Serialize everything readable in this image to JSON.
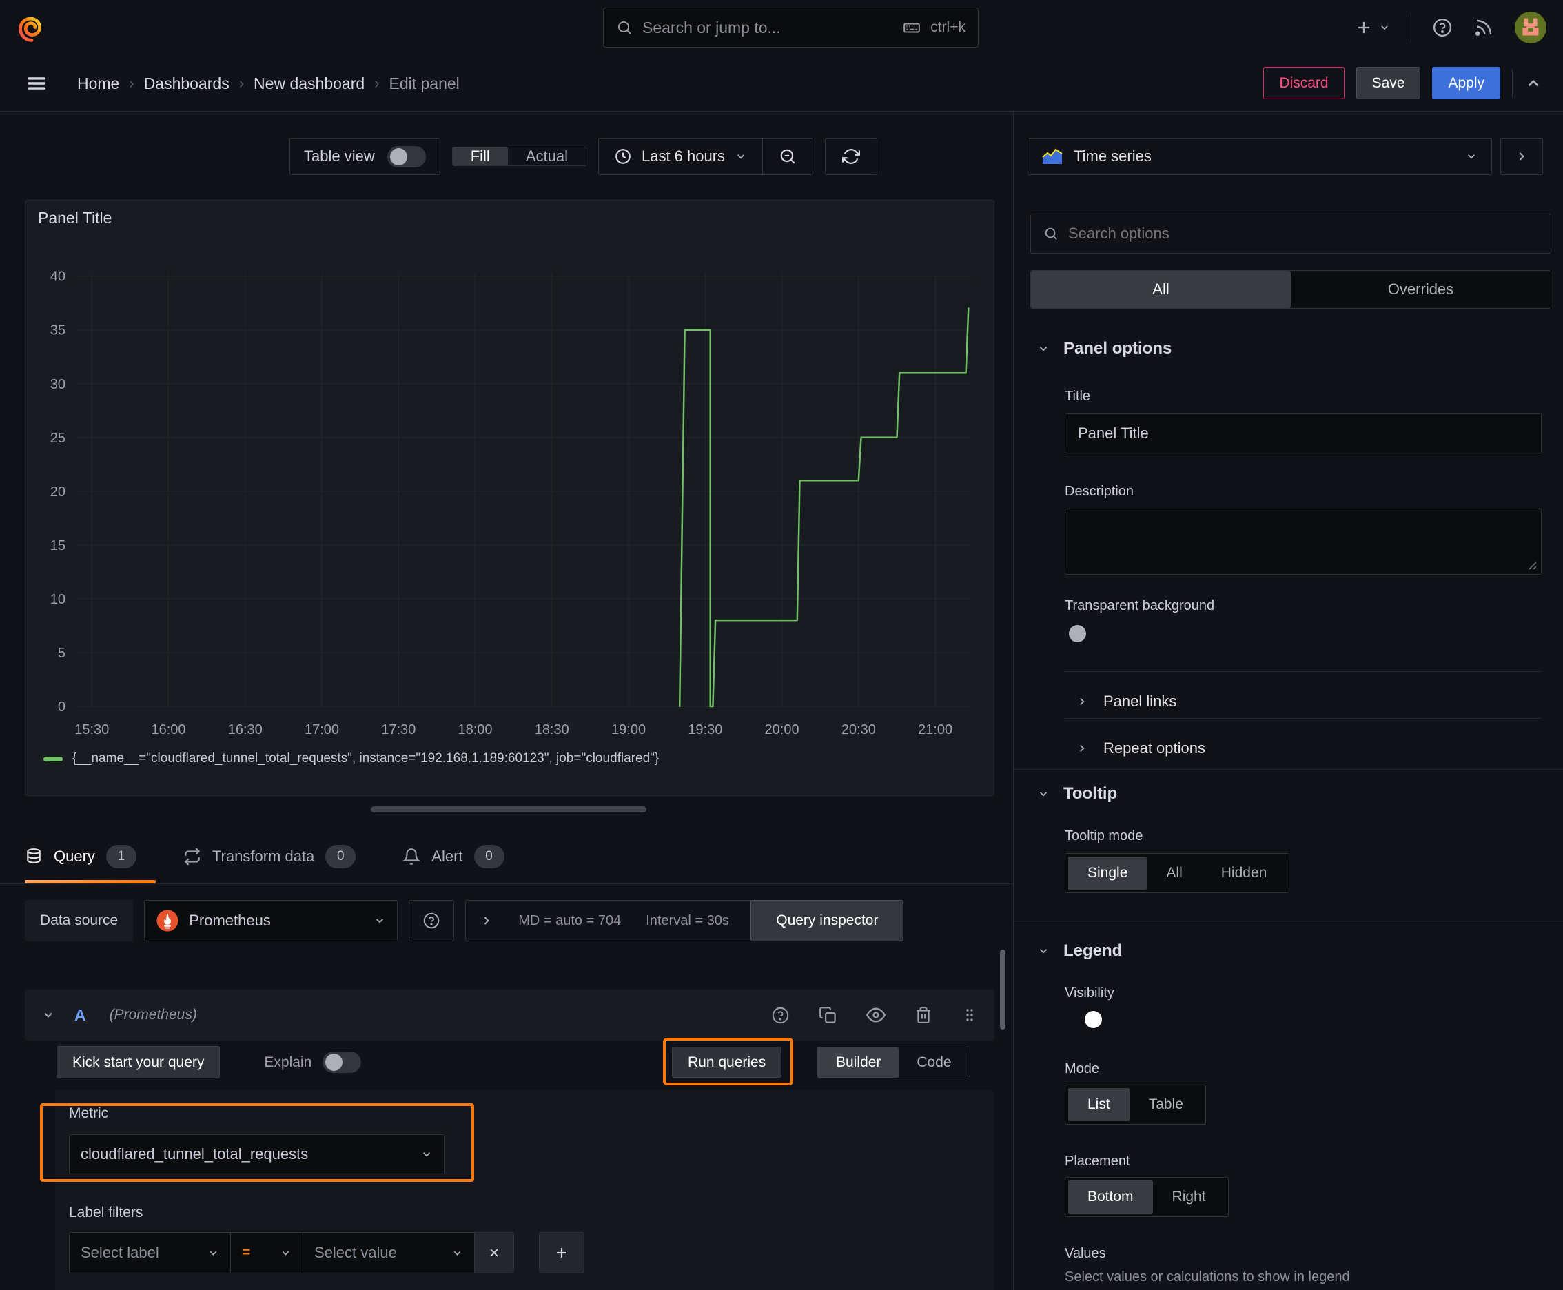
{
  "topbar": {
    "search_placeholder": "Search or jump to...",
    "shortcut": "ctrl+k"
  },
  "breadcrumb": {
    "items": [
      "Home",
      "Dashboards",
      "New dashboard",
      "Edit panel"
    ]
  },
  "actions": {
    "discard": "Discard",
    "save": "Save",
    "apply": "Apply"
  },
  "view_toolbar": {
    "table_view": "Table view",
    "fill": "Fill",
    "actual": "Actual",
    "time_range": "Last 6 hours"
  },
  "panel": {
    "title": "Panel Title"
  },
  "chart_data": {
    "type": "line",
    "title": "Panel Title",
    "x_ticks": [
      "15:30",
      "16:00",
      "16:30",
      "17:00",
      "17:30",
      "18:00",
      "18:30",
      "19:00",
      "19:30",
      "20:00",
      "20:30",
      "21:00"
    ],
    "y_ticks": [
      0,
      5,
      10,
      15,
      20,
      25,
      30,
      35,
      40
    ],
    "ylim": [
      0,
      40.3
    ],
    "x_window": [
      "15:24",
      "21:14"
    ],
    "grid": true,
    "legend_position": "bottom",
    "series": [
      {
        "name": "{__name__=\"cloudflared_tunnel_total_requests\", instance=\"192.168.1.189:60123\", job=\"cloudflared\"}",
        "color": "#73bf69",
        "points": [
          [
            "19:20",
            0
          ],
          [
            "19:22",
            35
          ],
          [
            "19:32",
            35
          ],
          [
            "19:32",
            0
          ],
          [
            "19:33",
            0
          ],
          [
            "19:34",
            8
          ],
          [
            "20:06",
            8
          ],
          [
            "20:07",
            21
          ],
          [
            "20:30",
            21
          ],
          [
            "20:31",
            25
          ],
          [
            "20:45",
            25
          ],
          [
            "20:46",
            31
          ],
          [
            "21:12",
            31
          ],
          [
            "21:13",
            37
          ]
        ]
      }
    ]
  },
  "tabs": {
    "query": {
      "label": "Query",
      "count": "1"
    },
    "transform": {
      "label": "Transform data",
      "count": "0"
    },
    "alert": {
      "label": "Alert",
      "count": "0"
    }
  },
  "query": {
    "datasource_label": "Data source",
    "datasource_value": "Prometheus",
    "expand_stats": {
      "md": "MD = auto = 704",
      "interval": "Interval = 30s"
    },
    "inspector_label": "Query inspector",
    "row_letter": "A",
    "row_datasource": "(Prometheus)",
    "kickstart_label": "Kick start your query",
    "explain_label": "Explain",
    "run_label": "Run queries",
    "builder_label": "Builder",
    "code_label": "Code",
    "metric_label": "Metric",
    "metric_value": "cloudflared_tunnel_total_requests",
    "label_filters_label": "Label filters",
    "select_label_placeholder": "Select label",
    "operator": "=",
    "select_value_placeholder": "Select value"
  },
  "options": {
    "viz_type": "Time series",
    "search_placeholder": "Search options",
    "tab_all": "All",
    "tab_overrides": "Overrides",
    "panel_options": {
      "header": "Panel options",
      "title_label": "Title",
      "title_value": "Panel Title",
      "description_label": "Description",
      "transparent_label": "Transparent background",
      "links_label": "Panel links",
      "repeat_label": "Repeat options"
    },
    "tooltip": {
      "header": "Tooltip",
      "mode_label": "Tooltip mode",
      "modes": [
        "Single",
        "All",
        "Hidden"
      ],
      "selected_mode": "Single"
    },
    "legend": {
      "header": "Legend",
      "visibility_label": "Visibility",
      "mode_label": "Mode",
      "modes": [
        "List",
        "Table"
      ],
      "selected_mode": "List",
      "placement_label": "Placement",
      "placements": [
        "Bottom",
        "Right"
      ],
      "selected_placement": "Bottom",
      "values_label": "Values",
      "values_hint": "Select values or calculations to show in legend"
    }
  },
  "colors": {
    "accent_orange": "#ff780a",
    "series_green": "#73bf69",
    "primary_blue": "#3d71d9",
    "discard_red": "#e0226c"
  }
}
